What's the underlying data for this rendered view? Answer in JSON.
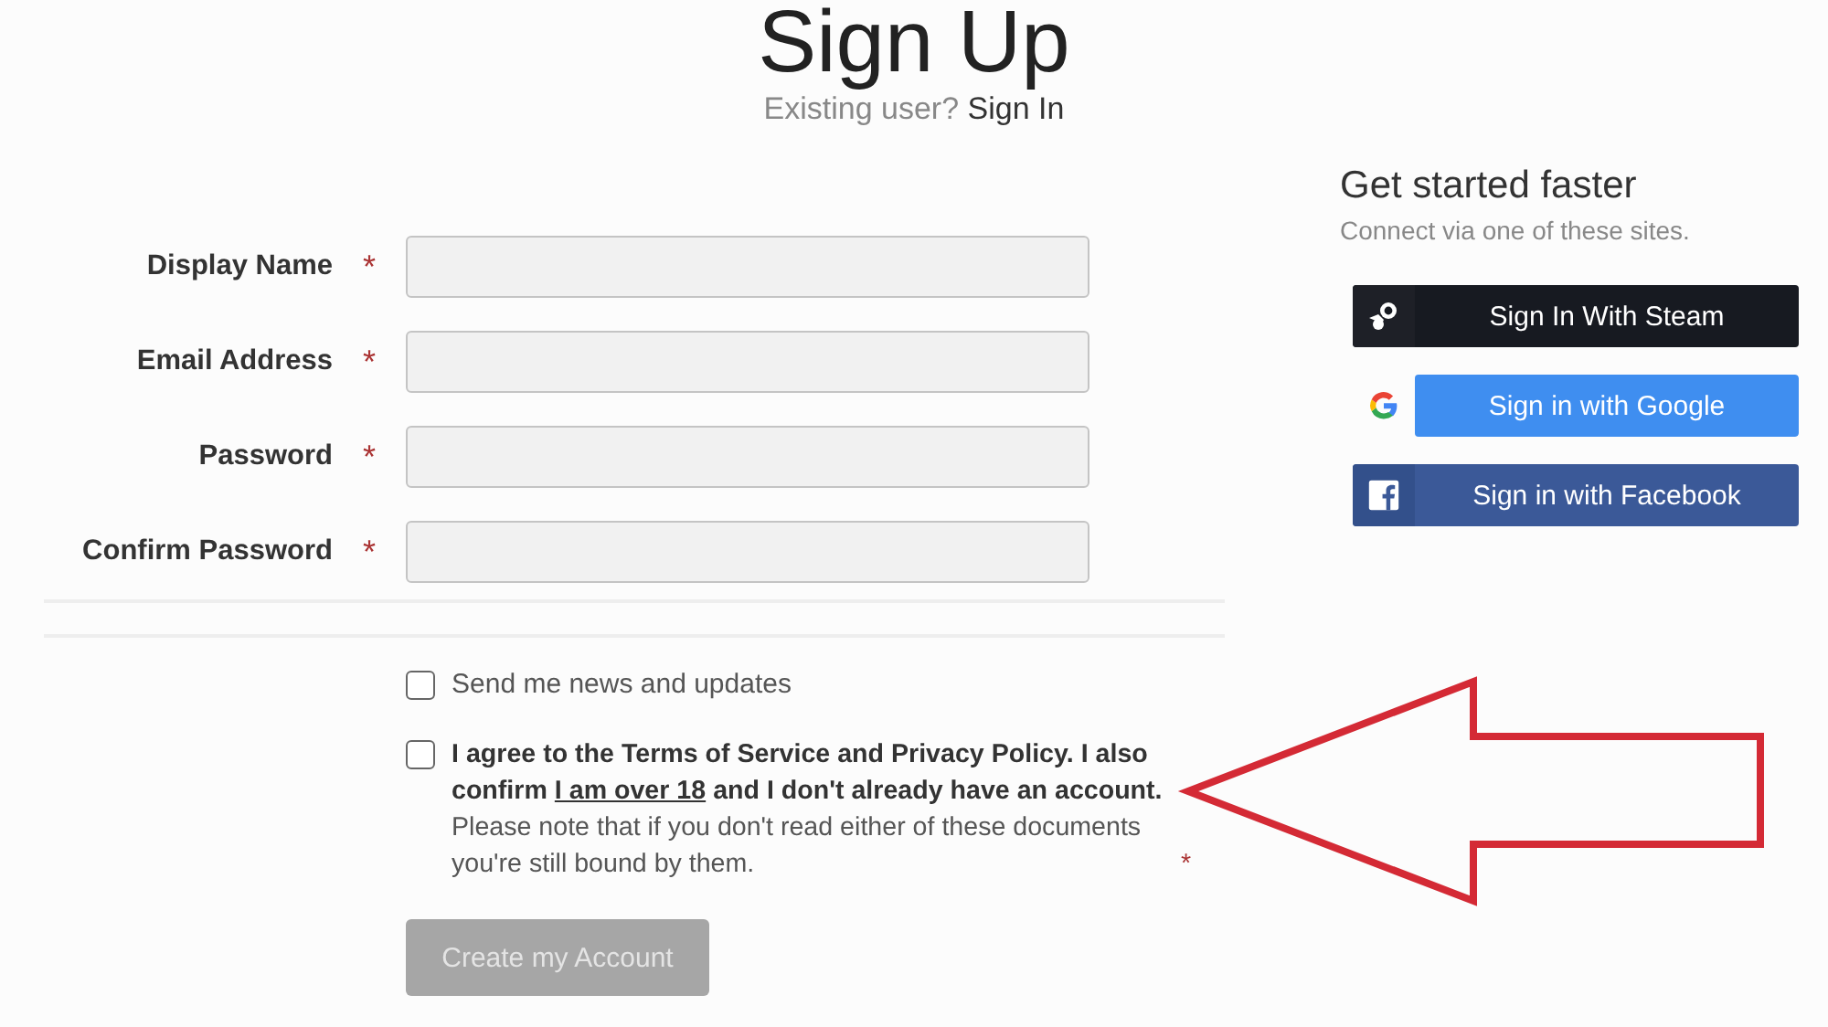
{
  "header": {
    "title": "Sign Up",
    "subtitle": "Existing user?",
    "sign_in_link": "Sign In"
  },
  "fields": [
    {
      "label": "Display Name",
      "required_mark": "*"
    },
    {
      "label": "Email Address",
      "required_mark": "*"
    },
    {
      "label": "Password",
      "required_mark": "*"
    },
    {
      "label": "Confirm Password",
      "required_mark": "*"
    }
  ],
  "newsletter": {
    "label": "Send me news and updates",
    "checked": false
  },
  "agreement": {
    "checked": false,
    "text_before": "I agree to the Terms of Service and Privacy Policy. I also confirm",
    "link": "I am over 18",
    "text_after": "and I don't already have an account.",
    "note": "Please note that if you don't read either of these documents you're still bound by them.",
    "required_mark": "*"
  },
  "submit": {
    "label": "Create my Account",
    "disabled": true
  },
  "social": {
    "title": "Get started faster",
    "subtitle": "Connect via one of these sites.",
    "buttons": [
      {
        "kind": "steam",
        "label": "Sign In With Steam"
      },
      {
        "kind": "google",
        "label": "Sign in with Google"
      },
      {
        "kind": "facebook",
        "label": "Sign in with Facebook"
      }
    ]
  }
}
